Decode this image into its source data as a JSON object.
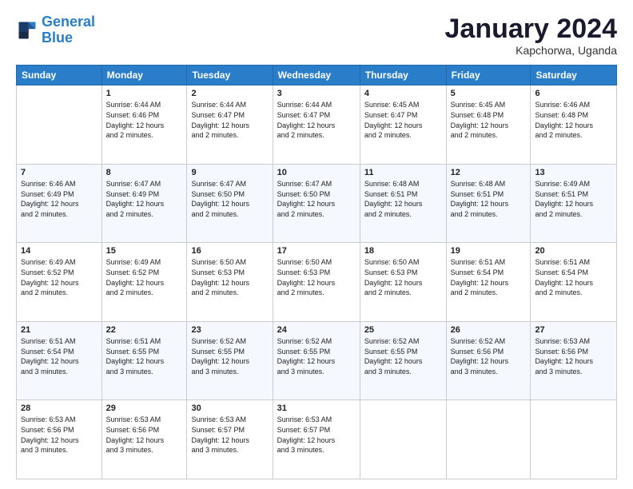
{
  "logo": {
    "line1": "General",
    "line2": "Blue"
  },
  "title": "January 2024",
  "location": "Kapchorwa, Uganda",
  "days_header": [
    "Sunday",
    "Monday",
    "Tuesday",
    "Wednesday",
    "Thursday",
    "Friday",
    "Saturday"
  ],
  "weeks": [
    [
      {
        "num": "",
        "info": ""
      },
      {
        "num": "1",
        "info": "Sunrise: 6:44 AM\nSunset: 6:46 PM\nDaylight: 12 hours\nand 2 minutes."
      },
      {
        "num": "2",
        "info": "Sunrise: 6:44 AM\nSunset: 6:47 PM\nDaylight: 12 hours\nand 2 minutes."
      },
      {
        "num": "3",
        "info": "Sunrise: 6:44 AM\nSunset: 6:47 PM\nDaylight: 12 hours\nand 2 minutes."
      },
      {
        "num": "4",
        "info": "Sunrise: 6:45 AM\nSunset: 6:47 PM\nDaylight: 12 hours\nand 2 minutes."
      },
      {
        "num": "5",
        "info": "Sunrise: 6:45 AM\nSunset: 6:48 PM\nDaylight: 12 hours\nand 2 minutes."
      },
      {
        "num": "6",
        "info": "Sunrise: 6:46 AM\nSunset: 6:48 PM\nDaylight: 12 hours\nand 2 minutes."
      }
    ],
    [
      {
        "num": "7",
        "info": "Sunrise: 6:46 AM\nSunset: 6:49 PM\nDaylight: 12 hours\nand 2 minutes."
      },
      {
        "num": "8",
        "info": "Sunrise: 6:47 AM\nSunset: 6:49 PM\nDaylight: 12 hours\nand 2 minutes."
      },
      {
        "num": "9",
        "info": "Sunrise: 6:47 AM\nSunset: 6:50 PM\nDaylight: 12 hours\nand 2 minutes."
      },
      {
        "num": "10",
        "info": "Sunrise: 6:47 AM\nSunset: 6:50 PM\nDaylight: 12 hours\nand 2 minutes."
      },
      {
        "num": "11",
        "info": "Sunrise: 6:48 AM\nSunset: 6:51 PM\nDaylight: 12 hours\nand 2 minutes."
      },
      {
        "num": "12",
        "info": "Sunrise: 6:48 AM\nSunset: 6:51 PM\nDaylight: 12 hours\nand 2 minutes."
      },
      {
        "num": "13",
        "info": "Sunrise: 6:49 AM\nSunset: 6:51 PM\nDaylight: 12 hours\nand 2 minutes."
      }
    ],
    [
      {
        "num": "14",
        "info": "Sunrise: 6:49 AM\nSunset: 6:52 PM\nDaylight: 12 hours\nand 2 minutes."
      },
      {
        "num": "15",
        "info": "Sunrise: 6:49 AM\nSunset: 6:52 PM\nDaylight: 12 hours\nand 2 minutes."
      },
      {
        "num": "16",
        "info": "Sunrise: 6:50 AM\nSunset: 6:53 PM\nDaylight: 12 hours\nand 2 minutes."
      },
      {
        "num": "17",
        "info": "Sunrise: 6:50 AM\nSunset: 6:53 PM\nDaylight: 12 hours\nand 2 minutes."
      },
      {
        "num": "18",
        "info": "Sunrise: 6:50 AM\nSunset: 6:53 PM\nDaylight: 12 hours\nand 2 minutes."
      },
      {
        "num": "19",
        "info": "Sunrise: 6:51 AM\nSunset: 6:54 PM\nDaylight: 12 hours\nand 2 minutes."
      },
      {
        "num": "20",
        "info": "Sunrise: 6:51 AM\nSunset: 6:54 PM\nDaylight: 12 hours\nand 2 minutes."
      }
    ],
    [
      {
        "num": "21",
        "info": "Sunrise: 6:51 AM\nSunset: 6:54 PM\nDaylight: 12 hours\nand 3 minutes."
      },
      {
        "num": "22",
        "info": "Sunrise: 6:51 AM\nSunset: 6:55 PM\nDaylight: 12 hours\nand 3 minutes."
      },
      {
        "num": "23",
        "info": "Sunrise: 6:52 AM\nSunset: 6:55 PM\nDaylight: 12 hours\nand 3 minutes."
      },
      {
        "num": "24",
        "info": "Sunrise: 6:52 AM\nSunset: 6:55 PM\nDaylight: 12 hours\nand 3 minutes."
      },
      {
        "num": "25",
        "info": "Sunrise: 6:52 AM\nSunset: 6:55 PM\nDaylight: 12 hours\nand 3 minutes."
      },
      {
        "num": "26",
        "info": "Sunrise: 6:52 AM\nSunset: 6:56 PM\nDaylight: 12 hours\nand 3 minutes."
      },
      {
        "num": "27",
        "info": "Sunrise: 6:53 AM\nSunset: 6:56 PM\nDaylight: 12 hours\nand 3 minutes."
      }
    ],
    [
      {
        "num": "28",
        "info": "Sunrise: 6:53 AM\nSunset: 6:56 PM\nDaylight: 12 hours\nand 3 minutes."
      },
      {
        "num": "29",
        "info": "Sunrise: 6:53 AM\nSunset: 6:56 PM\nDaylight: 12 hours\nand 3 minutes."
      },
      {
        "num": "30",
        "info": "Sunrise: 6:53 AM\nSunset: 6:57 PM\nDaylight: 12 hours\nand 3 minutes."
      },
      {
        "num": "31",
        "info": "Sunrise: 6:53 AM\nSunset: 6:57 PM\nDaylight: 12 hours\nand 3 minutes."
      },
      {
        "num": "",
        "info": ""
      },
      {
        "num": "",
        "info": ""
      },
      {
        "num": "",
        "info": ""
      }
    ]
  ]
}
